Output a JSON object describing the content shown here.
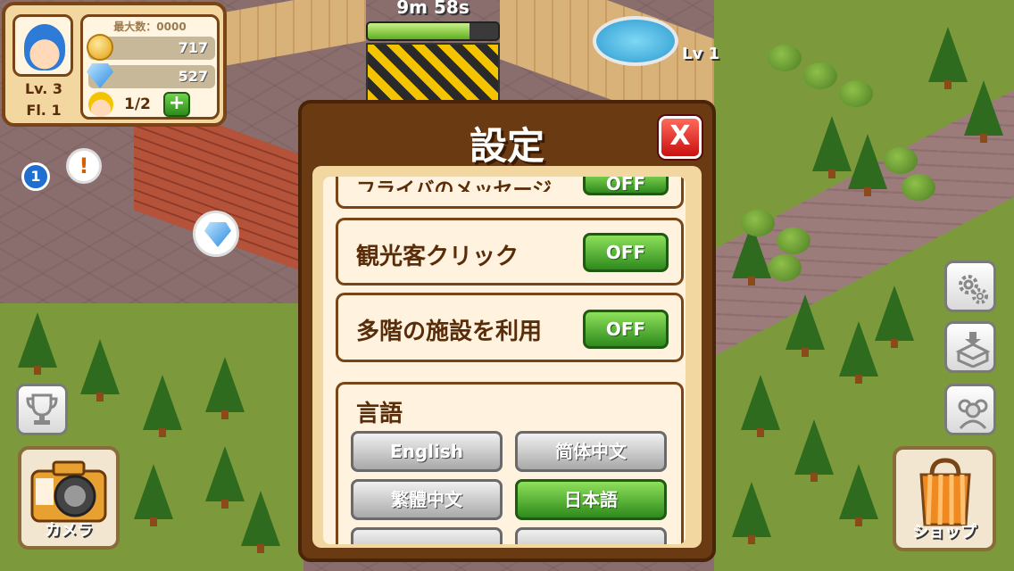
{
  "hud": {
    "max_label": "最大数：0000",
    "level": "Lv. 3",
    "floor": "Fl. 1",
    "coins": "717",
    "gems": "527",
    "workers": "1/2",
    "plus": "+"
  },
  "timer": {
    "label": "9m 58s",
    "progress": 0.78
  },
  "building_level": "Lv 1",
  "notifications": {
    "badge": "1",
    "alert": "!"
  },
  "sidebar_right": {
    "settings_icon": "gear-icon",
    "storage_icon": "box-icon",
    "friends_icon": "people-icon"
  },
  "shop": {
    "label": "ショップ"
  },
  "camera": {
    "label": "カメラ"
  },
  "modal": {
    "title": "設定",
    "close": "X",
    "partial_label": "フライバのメッセージ",
    "partial_value": "OFF",
    "options": [
      {
        "label": "観光客クリック",
        "value": "OFF"
      },
      {
        "label": "多階の施設を利用",
        "value": "OFF"
      }
    ],
    "language": {
      "heading": "言語",
      "options": [
        "English",
        "简体中文",
        "繁體中文",
        "日本語"
      ],
      "selected": "日本語"
    }
  }
}
